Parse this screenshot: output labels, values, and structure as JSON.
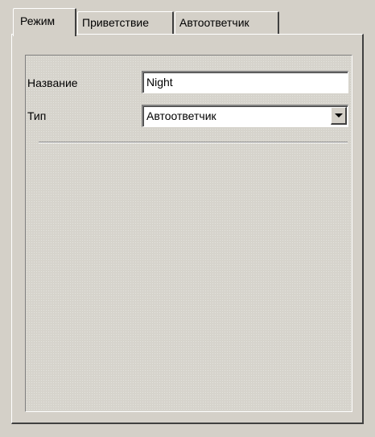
{
  "tabs": [
    {
      "label": "Режим",
      "active": true
    },
    {
      "label": "Приветствие",
      "active": false
    },
    {
      "label": "Автоответчик",
      "active": false
    }
  ],
  "form": {
    "name_label": "Название",
    "name_value": "Night",
    "type_label": "Тип",
    "type_value": "Автоответчик"
  },
  "icons": {
    "dropdown": "chevron-down-icon"
  },
  "colors": {
    "face": "#d4d0c8",
    "highlight": "#ffffff",
    "shadow": "#808080",
    "dark_shadow": "#404040",
    "field_background": "#ffffff"
  }
}
